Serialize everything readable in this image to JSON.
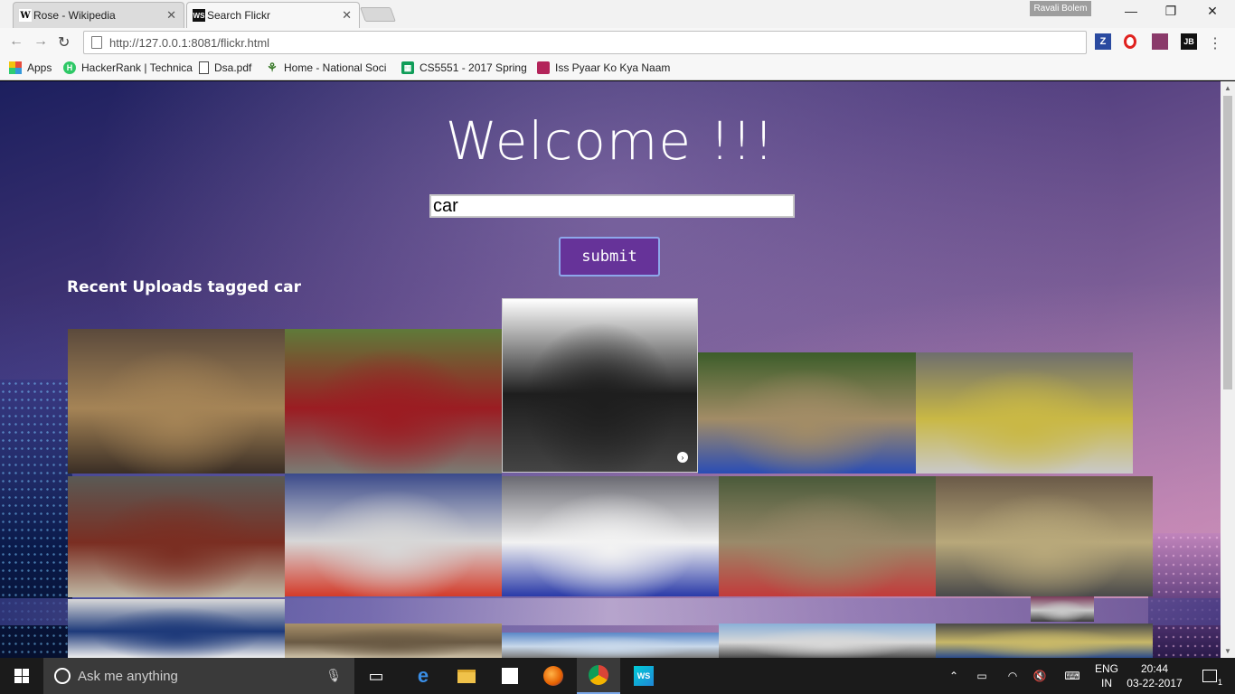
{
  "browser": {
    "tabs": [
      {
        "label": "Rose - Wikipedia",
        "favicon": "W",
        "active": false
      },
      {
        "label": "Search Flickr",
        "favicon": "WS",
        "active": true
      }
    ],
    "profile_name": "Ravali Bolem",
    "url": "http://127.0.0.1:8081/flickr.html",
    "url_host": "http://127.0.0.1",
    "url_rest": ":8081/flickr.html",
    "extensions": [
      "Z",
      "O",
      "JB"
    ],
    "window_controls": {
      "minimize": "—",
      "restore": "❐",
      "close": "✕"
    }
  },
  "bookmarks": [
    {
      "label": "Apps",
      "icon": "apps-grid-icon"
    },
    {
      "label": "HackerRank | Technica",
      "icon": "hackerrank-icon"
    },
    {
      "label": "Dsa.pdf",
      "icon": "document-icon"
    },
    {
      "label": "Home - National Soci",
      "icon": "tree-icon"
    },
    {
      "label": "CS5551 - 2017 Spring",
      "icon": "sheets-icon"
    },
    {
      "label": "Iss Pyaar Ko Kya Naam",
      "icon": "bookmark-icon"
    }
  ],
  "page": {
    "heading": "Welcome !!!",
    "search_value": "car",
    "submit_label": "submit",
    "results_title": "Recent Uploads tagged car"
  },
  "photos": [
    {
      "name": "photo-graffiti-train",
      "colors": [
        "#5b4a3c",
        "#a58456",
        "#3a2e25"
      ]
    },
    {
      "name": "photo-red-volvo",
      "colors": [
        "#5f7a3a",
        "#9b1c22",
        "#7b7b73"
      ]
    },
    {
      "name": "photo-car-batteries",
      "colors": [
        "#ffffff",
        "#1e1e1e",
        "#444444"
      ]
    },
    {
      "name": "photo-rally-blue-car",
      "colors": [
        "#3c5d2a",
        "#a28c66",
        "#2a4db5"
      ]
    },
    {
      "name": "photo-demolition-derby-1",
      "colors": [
        "#6e6e6e",
        "#c9b845",
        "#c9c9c9"
      ]
    },
    {
      "name": "photo-demolition-derby-2",
      "colors": [
        "#5a5a55",
        "#7a2e22",
        "#c0b9a5"
      ]
    },
    {
      "name": "photo-race-track-cars",
      "colors": [
        "#3b4a8a",
        "#d7d7d7",
        "#d43b2a"
      ]
    },
    {
      "name": "photo-777-race-car",
      "colors": [
        "#6a6a72",
        "#f2f2f2",
        "#2a3aa8"
      ]
    },
    {
      "name": "photo-derby-crash",
      "colors": [
        "#4a5a3a",
        "#9a8a6a",
        "#c23b3b"
      ]
    },
    {
      "name": "photo-derby-pile",
      "colors": [
        "#6a5a48",
        "#b8a87a",
        "#4a4a4a"
      ]
    },
    {
      "name": "photo-formula-car",
      "colors": [
        "#d8d8d8",
        "#1e3a7a",
        "#eeeeee"
      ]
    },
    {
      "name": "photo-dirt-track",
      "colors": [
        "#a8906a",
        "#6a5a44",
        "#cfc2a8"
      ]
    },
    {
      "name": "photo-blue-sky-track",
      "colors": [
        "#5a88c8",
        "#c8d8ea",
        "#7a7a7a"
      ]
    },
    {
      "name": "photo-grandstand",
      "colors": [
        "#8ab0d8",
        "#d8d8d8",
        "#4a4a4a"
      ]
    },
    {
      "name": "photo-race-pack",
      "colors": [
        "#4a4a4a",
        "#c8b868",
        "#2a4a8a"
      ]
    },
    {
      "name": "photo-partial-top",
      "colors": [
        "#7a3a5a",
        "#c8c8c8",
        "#3a3a3a"
      ]
    }
  ],
  "taskbar": {
    "search_placeholder": "Ask me anything",
    "language_top": "ENG",
    "language_bottom": "IN",
    "time": "20:44",
    "date": "03-22-2017",
    "notification_count": "1",
    "apps": [
      "task-view-icon",
      "edge-icon",
      "file-explorer-icon",
      "store-icon",
      "firefox-icon",
      "chrome-icon",
      "webstorm-icon"
    ]
  },
  "colors": {
    "submit_bg": "#663399",
    "submit_border": "#8da7ea",
    "taskbar_bg": "#1b1b1b"
  }
}
